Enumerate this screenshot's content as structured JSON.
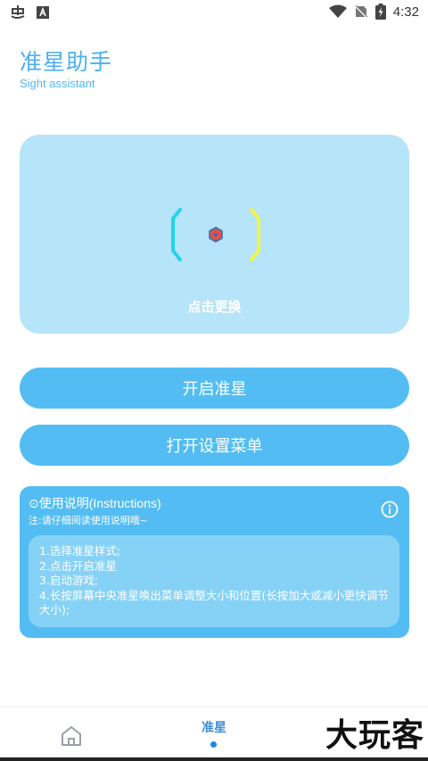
{
  "status_bar": {
    "time": "4:32",
    "icons": [
      "notification-app-icon",
      "notification-a-icon",
      "wifi-icon",
      "no-sim-icon",
      "battery-icon"
    ]
  },
  "header": {
    "title": "准星助手",
    "subtitle": "Sight assistant"
  },
  "preview": {
    "change_label": "点击更换",
    "colors": {
      "left_bracket": "#22d3ee",
      "right_bracket": "#f2f542",
      "center": "#e05050"
    }
  },
  "buttons": {
    "start_label": "开启准星",
    "settings_label": "打开设置菜单"
  },
  "instructions": {
    "title": "⊙使用说明(Instructions)",
    "note": "注:请仔细阅读使用说明哦~",
    "steps": [
      "1.选择准星样式;",
      "2.点击开启准星",
      "3.启动游戏;",
      "4.长按屏幕中央准星唤出菜单调整大小和位置(长按加大或减小更快调节大小);"
    ]
  },
  "bottom_nav": {
    "active_tab_label": "准星",
    "watermark": "大玩客"
  },
  "colors": {
    "accent": "#53bdf3",
    "title": "#4ab0ef",
    "card_bg": "#b6e4f9",
    "nav_active": "#3d8fd9"
  }
}
